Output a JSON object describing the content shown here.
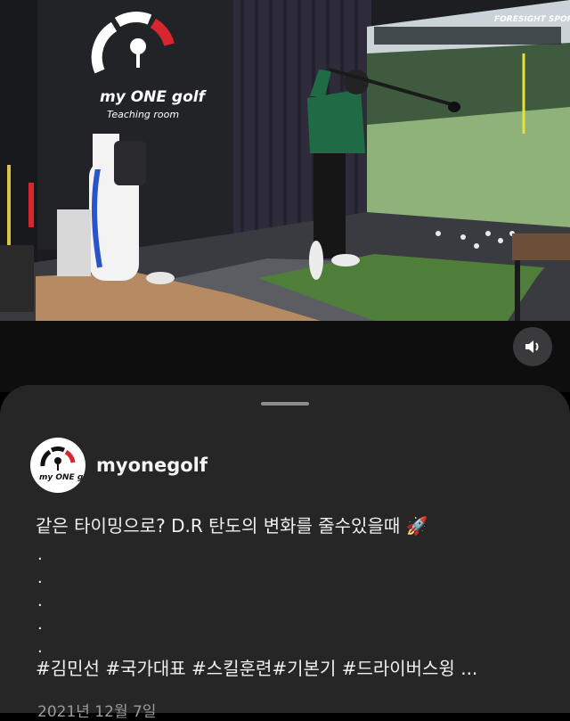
{
  "video": {
    "brand_word": "my ONE golf",
    "brand_subtitle": "Teaching room",
    "simulator_brand": "FORESIGHT SPORTS",
    "sound_icon": "speaker-icon"
  },
  "post": {
    "username": "myonegolf",
    "avatar_text": "my ONE golf",
    "caption": "같은 타이밍으로? D.R 탄도의  변화를 줄수있을때 🚀",
    "dots": [
      ".",
      ".",
      ".",
      ".",
      "."
    ],
    "hashtags": "#김민선 #국가대표 #스킬훈련#기본기 #드라이버스윙 ...",
    "date": "2021년 12월 7일"
  },
  "colors": {
    "sheet_bg": "#262626",
    "accent_red": "#d8262e"
  }
}
